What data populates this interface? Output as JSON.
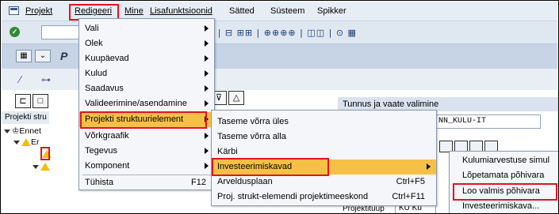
{
  "menubar": {
    "items": [
      "Projekt",
      "Redigeeri",
      "Mine",
      "Lisafunktsioonid",
      "Sätted",
      "Süsteem",
      "Spikker"
    ]
  },
  "toolbar": {
    "glyphs": "⊗ | ⊟ ⊞⊞ | ⊕⊕⊕⊕ | ◫◫ | ⊙ ▦"
  },
  "title": {
    "text": "P"
  },
  "left_panel": {
    "header": "Projekti stru",
    "tree": [
      "Ennet",
      "Er"
    ]
  },
  "right_panel": {
    "header": "Tunnus ja vaate valimine",
    "input_value": "NN_KULU-IT",
    "label": "Projektituup",
    "value": "KU Ku"
  },
  "menu_edit": {
    "items": [
      {
        "label": "Vali"
      },
      {
        "label": "Olek"
      },
      {
        "label": "Kuupäevad"
      },
      {
        "label": "Kulud"
      },
      {
        "label": "Saadavus"
      },
      {
        "label": "Valideerimine/asendamine"
      },
      {
        "label": "Projekti struktuurielement"
      },
      {
        "label": "Võrkgraafik"
      },
      {
        "label": "Tegevus"
      },
      {
        "label": "Komponent"
      },
      {
        "label": "Tühista",
        "shortcut": "F12"
      }
    ]
  },
  "menu_wbs": {
    "items": [
      {
        "label": "Taseme võrra üles"
      },
      {
        "label": "Taseme võrra alla"
      },
      {
        "label": "Kärbi"
      },
      {
        "label": "Investeerimiskavad"
      },
      {
        "label": "Arveldusplaan",
        "shortcut": "Ctrl+F5"
      },
      {
        "label": "Proj. strukt-elemendi projektimeeskond",
        "shortcut": "Ctrl+F11"
      }
    ]
  },
  "menu_invest": {
    "items": [
      {
        "label": "Kulumiarvestuse simul"
      },
      {
        "label": "Lõpetamata põhivara"
      },
      {
        "label": "Loo valmis põhivara"
      },
      {
        "label": "Investeerimiskava..."
      }
    ]
  },
  "colors": {
    "highlight": "#f6c046",
    "annotation_red": "#e0141e"
  }
}
